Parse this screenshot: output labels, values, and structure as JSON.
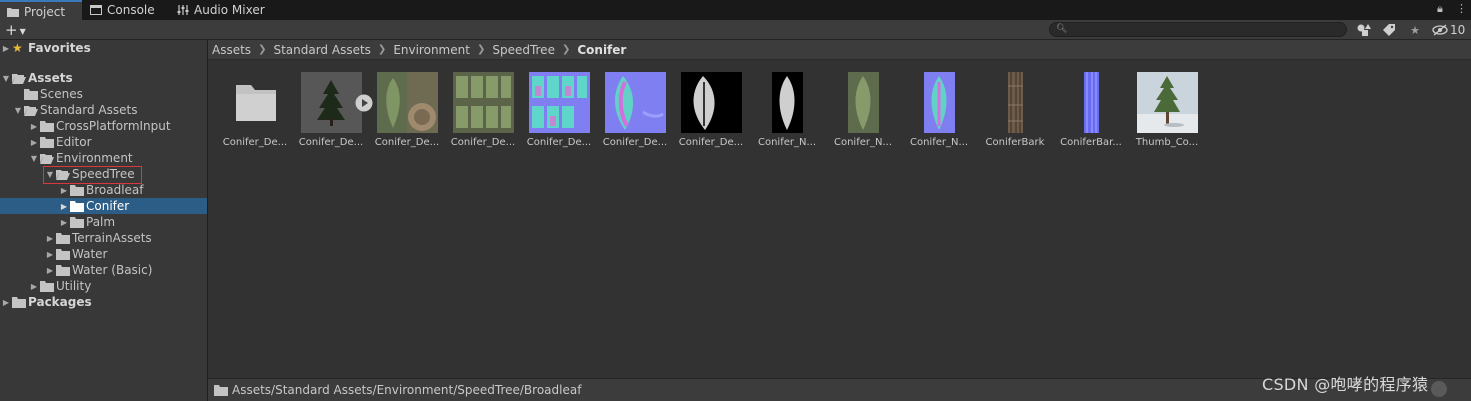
{
  "tabs": [
    {
      "label": "Project",
      "icon": "folder-icon",
      "active": true
    },
    {
      "label": "Console",
      "icon": "console-icon",
      "active": false
    },
    {
      "label": "Audio Mixer",
      "icon": "audio-mixer-icon",
      "active": false
    }
  ],
  "toolbar": {
    "plus": "+",
    "hidden_count": "10"
  },
  "tree": [
    {
      "label": "Favorites",
      "bold": true,
      "star": true
    },
    {
      "label": "Assets",
      "bold": true
    },
    {
      "label": "Scenes"
    },
    {
      "label": "Standard Assets"
    },
    {
      "label": "CrossPlatformInput"
    },
    {
      "label": "Editor"
    },
    {
      "label": "Environment"
    },
    {
      "label": "SpeedTree"
    },
    {
      "label": "Broadleaf"
    },
    {
      "label": "Conifer",
      "selected": true
    },
    {
      "label": "Palm"
    },
    {
      "label": "TerrainAssets"
    },
    {
      "label": "Water"
    },
    {
      "label": "Water (Basic)"
    },
    {
      "label": "Utility"
    },
    {
      "label": "Packages",
      "bold": true
    }
  ],
  "breadcrumb": [
    "Assets",
    "Standard Assets",
    "Environment",
    "SpeedTree",
    "Conifer"
  ],
  "assets": [
    {
      "label": "Conifer_De...",
      "kind": "folder"
    },
    {
      "label": "Conifer_De...",
      "kind": "prefab"
    },
    {
      "label": "Conifer_De...",
      "kind": "diffuse-atlas"
    },
    {
      "label": "Conifer_De...",
      "kind": "branch-atlas"
    },
    {
      "label": "Conifer_De...",
      "kind": "normal-atlas"
    },
    {
      "label": "Conifer_De...",
      "kind": "normal-leaf"
    },
    {
      "label": "Conifer_De...",
      "kind": "mask-leaf"
    },
    {
      "label": "Conifer_N...",
      "kind": "mask-narrow"
    },
    {
      "label": "Conifer_N...",
      "kind": "diffuse-narrow"
    },
    {
      "label": "Conifer_N...",
      "kind": "normal-narrow"
    },
    {
      "label": "ConiferBark",
      "kind": "bark"
    },
    {
      "label": "ConiferBar...",
      "kind": "bark-normal"
    },
    {
      "label": "Thumb_Co...",
      "kind": "thumbnail"
    }
  ],
  "status": {
    "path": "Assets/Standard Assets/Environment/SpeedTree/Broadleaf"
  },
  "watermark": "CSDN @咆哮的程序猿",
  "colors": {
    "selection": "#2c5d87",
    "highlight_box": "#d9363e",
    "tab_accent": "#3a79bb"
  }
}
